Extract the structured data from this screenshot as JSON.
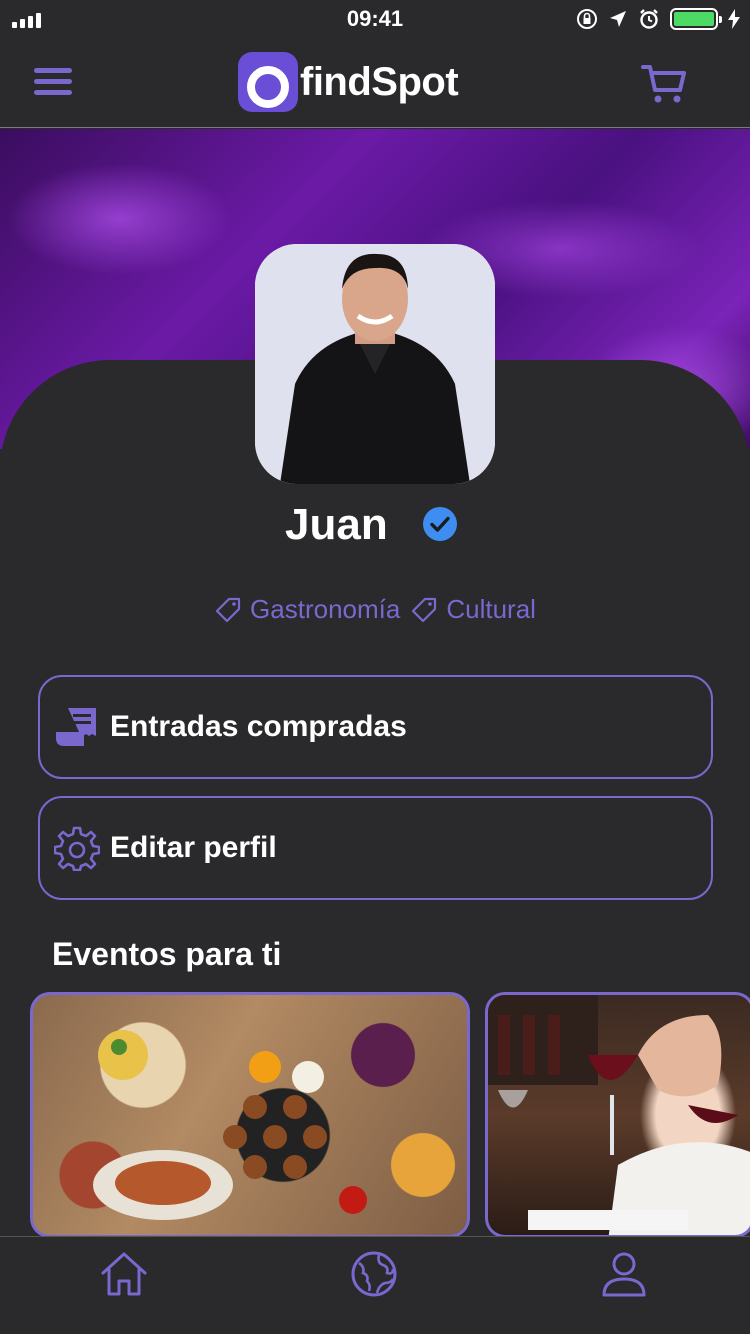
{
  "status_bar": {
    "time": "09:41",
    "battery_percent": 100
  },
  "header": {
    "app_name": "findSpot"
  },
  "profile": {
    "name": "Juan",
    "verified": true,
    "tags": [
      {
        "label": "Gastronomía"
      },
      {
        "label": "Cultural"
      }
    ]
  },
  "actions": [
    {
      "label": "Entradas compradas",
      "icon": "ticket-icon"
    },
    {
      "label": "Editar perfil",
      "icon": "gear-icon"
    }
  ],
  "events_section": {
    "title": "Eventos para ti"
  },
  "tab_bar": {
    "items": [
      "home-icon",
      "globe-icon",
      "user-icon"
    ]
  },
  "colors": {
    "accent": "#7b68cf",
    "background": "#2a292b",
    "verified": "#3d8ef0",
    "battery": "#4cd964"
  }
}
